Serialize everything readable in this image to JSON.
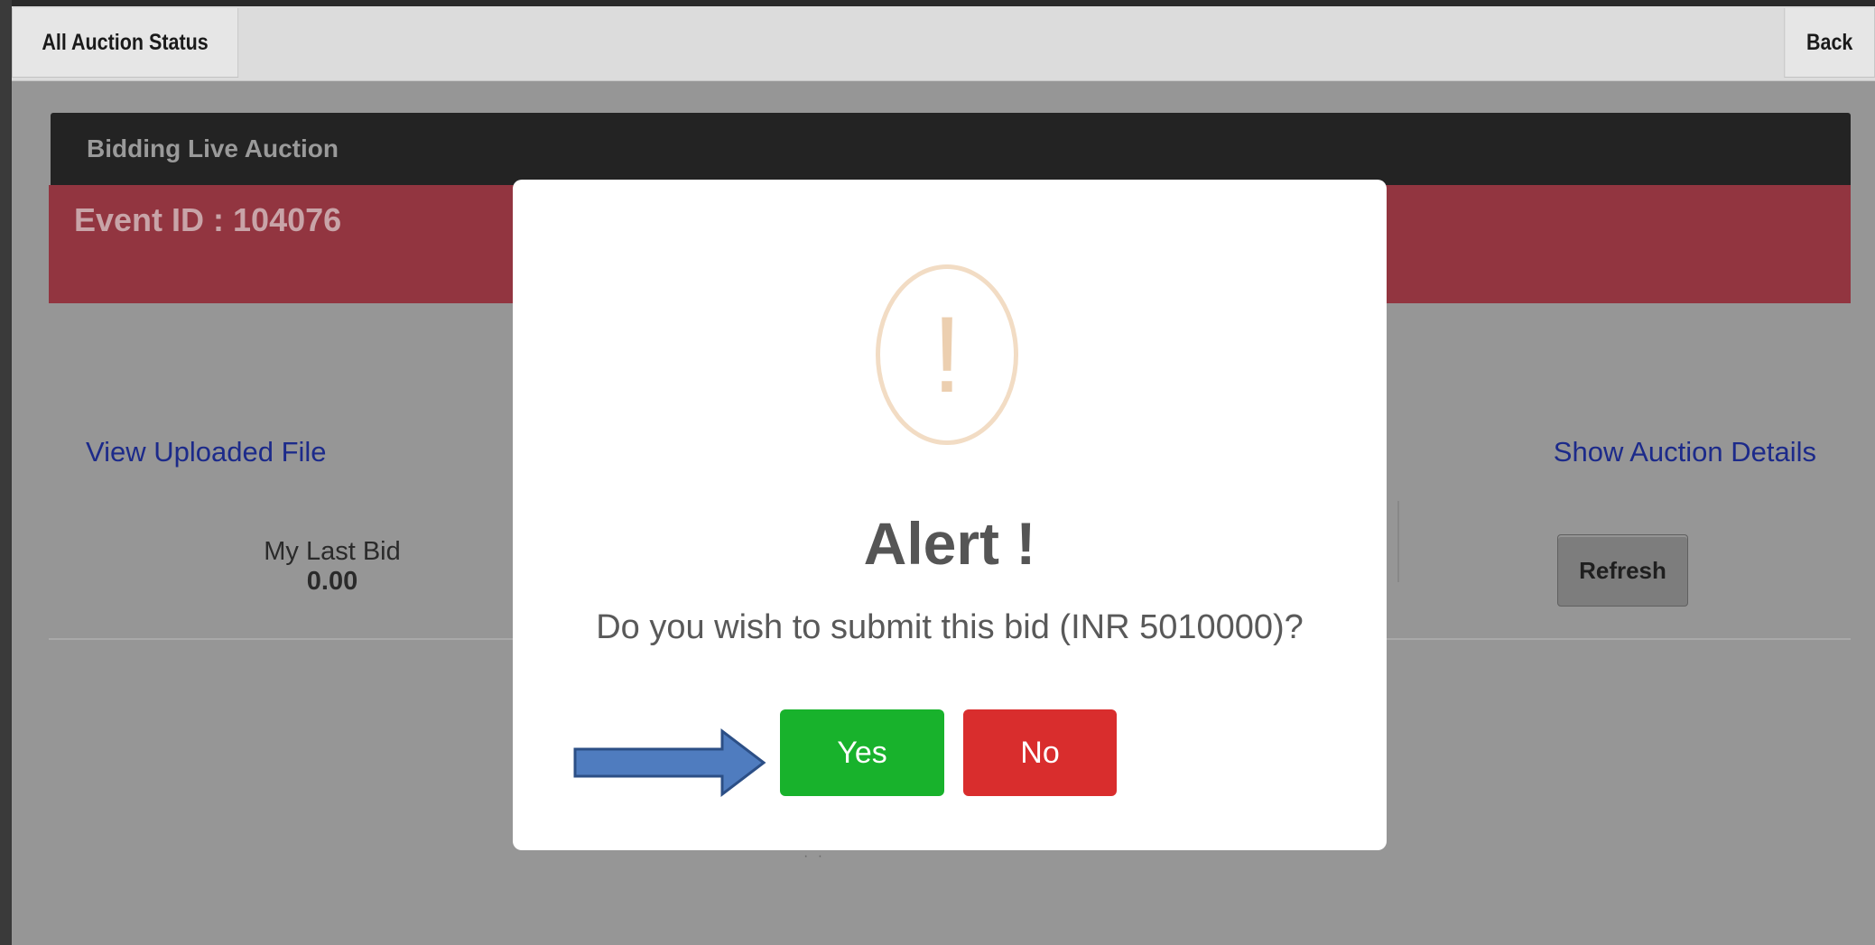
{
  "toolbar": {
    "all_auction_status_label": "All Auction Status",
    "back_label": "Back"
  },
  "panel": {
    "header_title": "Bidding Live Auction",
    "event_id_text": "Event ID : 104076"
  },
  "links": {
    "view_uploaded_file": "View Uploaded File",
    "show_auction_details": "Show Auction Details"
  },
  "bid": {
    "my_last_bid_label": "My Last Bid",
    "my_last_bid_value": "0.00"
  },
  "actions": {
    "refresh_label": "Refresh"
  },
  "modal": {
    "icon": "exclamation-icon",
    "title": "Alert !",
    "message": "Do you wish to submit this bid (INR 5010000)?",
    "yes_label": "Yes",
    "no_label": "No"
  },
  "annotation": {
    "pointer_icon": "arrow-right-icon"
  },
  "colors": {
    "header_bg": "#232323",
    "event_bar_bg": "#923540",
    "yes_button": "#18b22c",
    "no_button": "#d92d2d",
    "link": "#1c2a8a",
    "arrow": "#4f7cbf"
  }
}
